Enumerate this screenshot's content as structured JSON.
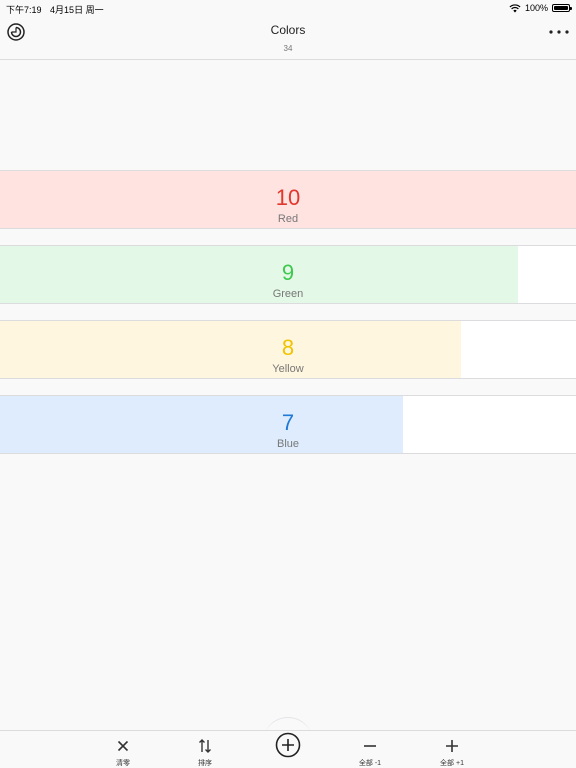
{
  "status_bar": {
    "time": "下午7:19",
    "date": "4月15日 周一",
    "battery": "100%",
    "battery_level": 1.0
  },
  "nav": {
    "title": "Colors",
    "subtitle": "34",
    "history_icon": "history-icon",
    "more_icon": "more-icon"
  },
  "counters": [
    {
      "value": "10",
      "name": "Red",
      "fraction": 1.0,
      "fill_color": "#ffe3e1",
      "value_color": "#e2372c"
    },
    {
      "value": "9",
      "name": "Green",
      "fraction": 0.9,
      "fill_color": "#e3f8e6",
      "value_color": "#3fc84f"
    },
    {
      "value": "8",
      "name": "Yellow",
      "fraction": 0.8,
      "fill_color": "#fff6df",
      "value_color": "#f0c400"
    },
    {
      "value": "7",
      "name": "Blue",
      "fraction": 0.7,
      "fill_color": "#deecfd",
      "value_color": "#1f7ad8"
    }
  ],
  "toolbar": {
    "reset_label": "清零",
    "sort_label": "排序",
    "minus_all_label": "全部 -1",
    "plus_all_label": "全部 +1",
    "add_icon": "add-circle-icon"
  }
}
